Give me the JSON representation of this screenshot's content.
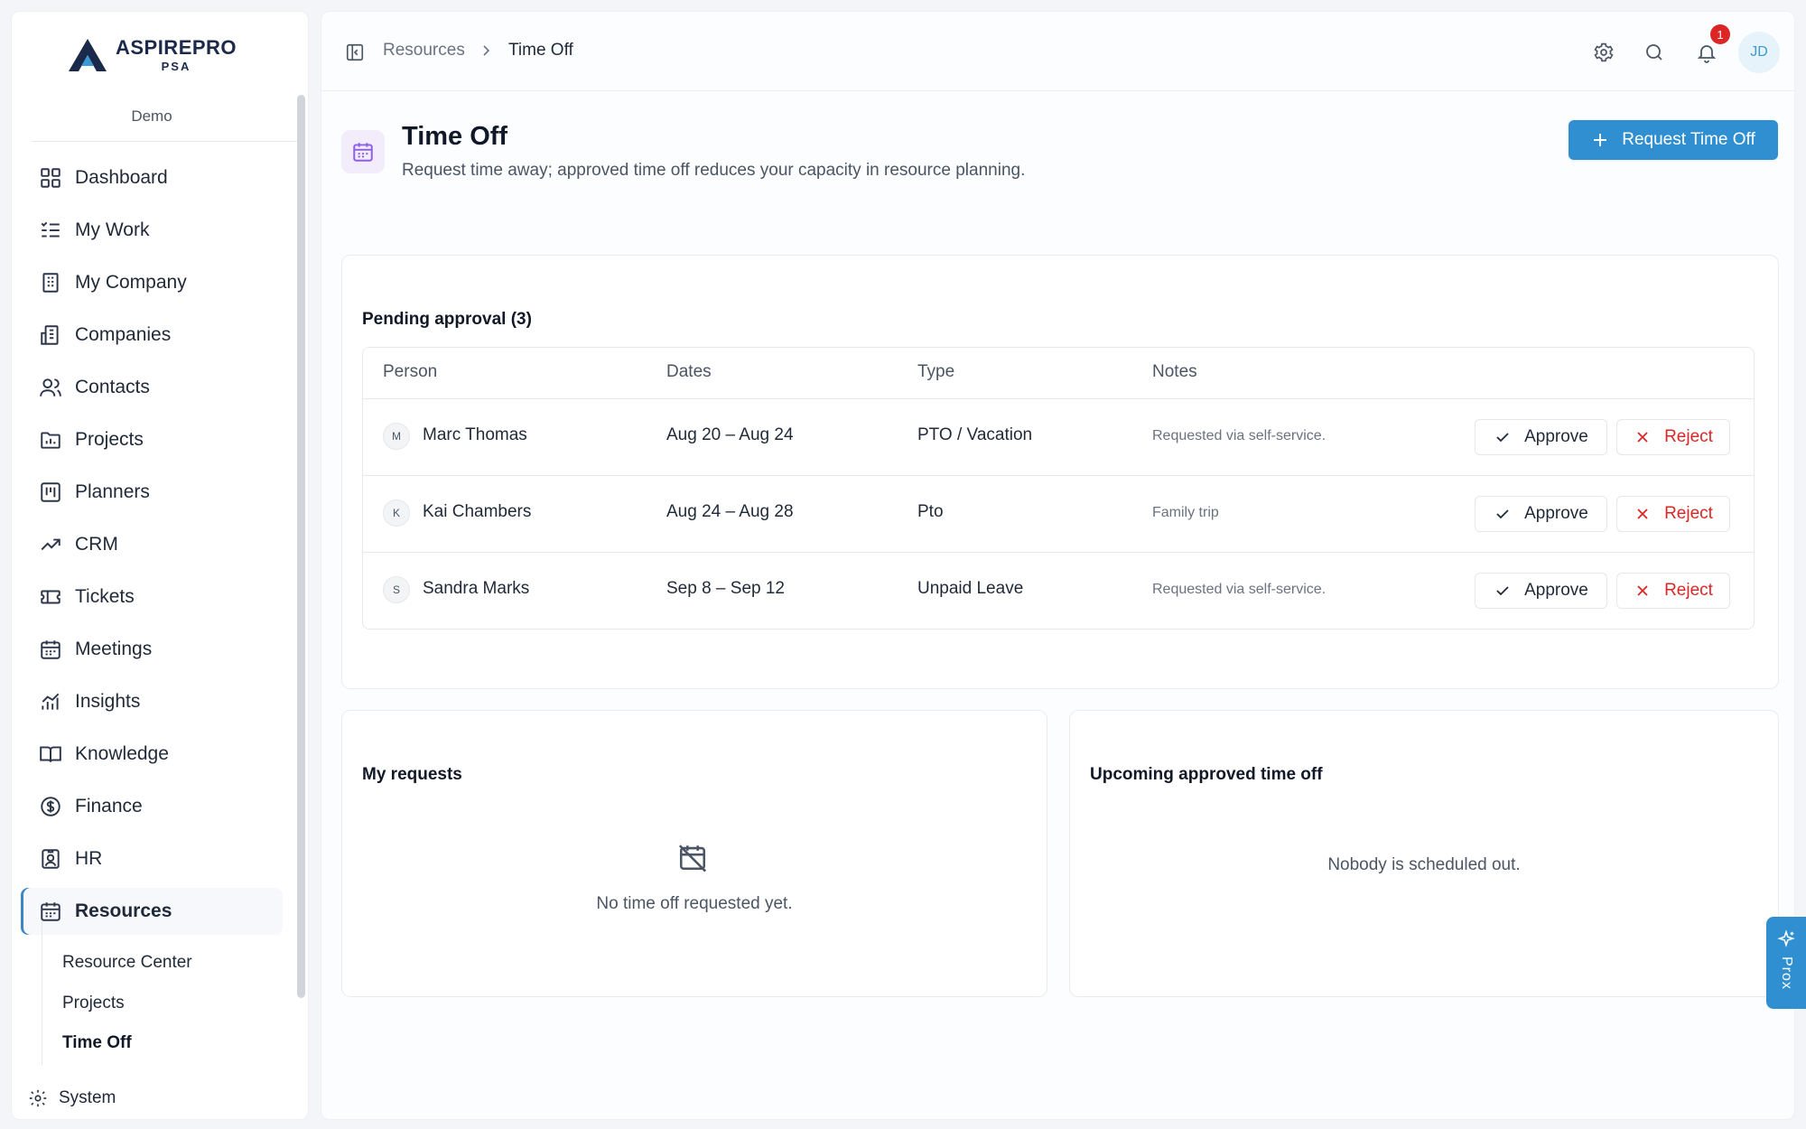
{
  "sidebar": {
    "brand_name": "ASPIREPRO",
    "brand_sub": "PSA",
    "org": "Demo",
    "items": [
      {
        "label": "Dashboard",
        "icon": "grid-icon"
      },
      {
        "label": "My Work",
        "icon": "list-check-icon"
      },
      {
        "label": "My Company",
        "icon": "building-icon"
      },
      {
        "label": "Companies",
        "icon": "buildings-icon"
      },
      {
        "label": "Contacts",
        "icon": "users-icon"
      },
      {
        "label": "Projects",
        "icon": "folder-icon"
      },
      {
        "label": "Planners",
        "icon": "kanban-icon"
      },
      {
        "label": "CRM",
        "icon": "trend-icon"
      },
      {
        "label": "Tickets",
        "icon": "ticket-icon"
      },
      {
        "label": "Meetings",
        "icon": "calendar-icon"
      },
      {
        "label": "Insights",
        "icon": "chart-icon"
      },
      {
        "label": "Knowledge",
        "icon": "book-icon"
      },
      {
        "label": "Finance",
        "icon": "dollar-icon"
      },
      {
        "label": "HR",
        "icon": "id-badge-icon"
      },
      {
        "label": "Resources",
        "icon": "calendar-icon"
      }
    ],
    "sub_items": [
      {
        "label": "Resource Center"
      },
      {
        "label": "Projects"
      },
      {
        "label": "Time Off"
      }
    ],
    "system": "System"
  },
  "header": {
    "breadcrumb": [
      "Resources",
      "Time Off"
    ],
    "notification_count": "1",
    "user_initials": "JD"
  },
  "page": {
    "title": "Time Off",
    "subtitle": "Request time away; approved time off reduces your capacity in resource planning.",
    "request_button": "Request Time Off"
  },
  "pending": {
    "title": "Pending approval (3)",
    "columns": [
      "Person",
      "Dates",
      "Type",
      "Notes"
    ],
    "rows": [
      {
        "initial": "M",
        "person": "Marc Thomas",
        "dates": "Aug 20 – Aug 24",
        "type": "PTO / Vacation",
        "notes": "Requested via self-service."
      },
      {
        "initial": "K",
        "person": "Kai Chambers",
        "dates": "Aug 24 – Aug 28",
        "type": "Pto",
        "notes": "Family trip"
      },
      {
        "initial": "S",
        "person": "Sandra Marks",
        "dates": "Sep 8 – Sep 12",
        "type": "Unpaid Leave",
        "notes": "Requested via self-service."
      }
    ],
    "approve_label": "Approve",
    "reject_label": "Reject"
  },
  "my_requests": {
    "title": "My requests",
    "empty": "No time off requested yet."
  },
  "upcoming": {
    "title": "Upcoming approved time off",
    "empty": "Nobody is scheduled out."
  },
  "assistant": {
    "label": "Prox"
  },
  "colors": {
    "accent": "#2f8fd1",
    "reject": "#dc2626",
    "badge": "#dc2626",
    "page_icon": "#8b5cf6"
  }
}
